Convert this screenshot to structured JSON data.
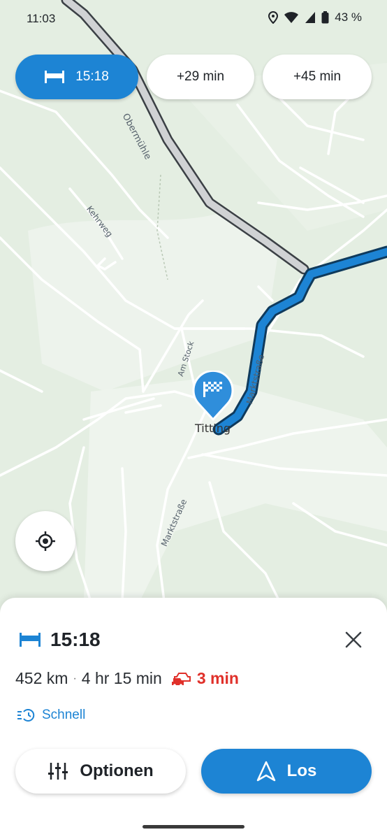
{
  "status_bar": {
    "time": "11:03",
    "battery": "43 %"
  },
  "route_chips": {
    "primary": "15:18",
    "alt1": "+29 min",
    "alt2": "+45 min"
  },
  "map": {
    "labels": {
      "oberm": "Obermühle",
      "kehrweg": "Kehrweg",
      "amstock": "Am Stock",
      "markt1": "Marktstraße",
      "markt2": "Marktstraße",
      "titting": "Titting",
      "edge": "rg"
    }
  },
  "sheet": {
    "eta": "15:18",
    "distance": "452 km",
    "duration": "4 hr 15 min",
    "traffic": "3 min",
    "mode": "Schnell",
    "options_label": "Optionen",
    "go_label": "Los"
  },
  "colors": {
    "accent": "#1d84d4",
    "traffic": "#e0302a",
    "route_alt": "#cfd1d3"
  }
}
